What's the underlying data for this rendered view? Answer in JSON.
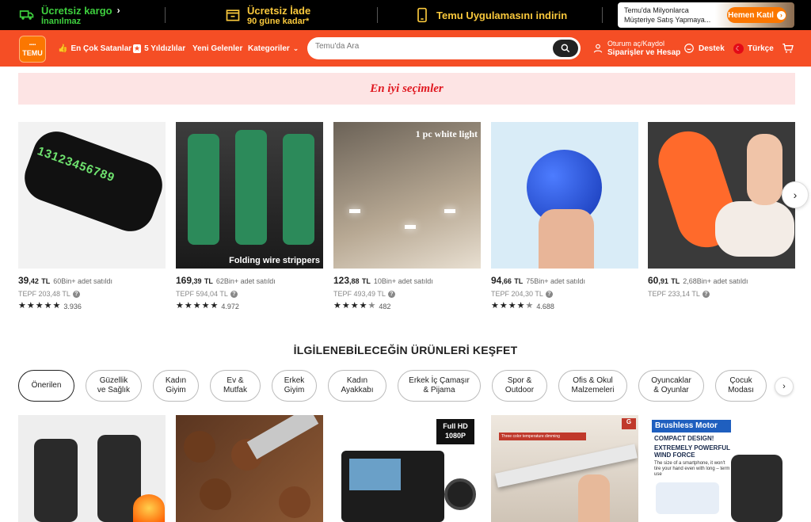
{
  "promo": {
    "shipping_title": "Ücretsiz kargo",
    "shipping_sub": "İnanılmaz",
    "return_title": "Ücretsiz İade",
    "return_sub": "90 güne kadar*",
    "app_title": "Temu Uygulamasını indirin",
    "ad_line1": "Temu'da Milyonlarca",
    "ad_line2": "Müşteriye Satış Yapmaya...",
    "ad_button": "Hemen Katıl"
  },
  "header": {
    "logo_top": "▪▪▪▪",
    "logo_text": "TEMU",
    "nav": [
      "En Çok Satanlar",
      "5 Yıldızlılar",
      "Yeni Gelenler",
      "Kategoriler"
    ],
    "search_placeholder": "Temu'da Ara",
    "account_line1": "Oturum aç/Kaydol",
    "account_line2": "Siparişler ve Hesap",
    "support": "Destek",
    "language": "Türkçe"
  },
  "banner": {
    "title": "En iyi seçimler"
  },
  "products": [
    {
      "price_int": "39",
      "price_dec": ",42",
      "currency": "TL",
      "sold": "60Bin+ adet satıldı",
      "rrp": "TEPF 203,48 TL",
      "stars": 5,
      "reviews": "3.936",
      "image_text": "13123456789"
    },
    {
      "price_int": "169",
      "price_dec": ",39",
      "currency": "TL",
      "sold": "62Bin+ adet satıldı",
      "rrp": "TEPF 594,04 TL",
      "stars": 5,
      "reviews": "4.972",
      "image_text": "Folding wire strippers"
    },
    {
      "price_int": "123",
      "price_dec": ",88",
      "currency": "TL",
      "sold": "10Bin+ adet satıldı",
      "rrp": "TEPF 493,49 TL",
      "stars": 4.5,
      "reviews": "482",
      "image_text": "1 pc white light"
    },
    {
      "price_int": "94",
      "price_dec": ",66",
      "currency": "TL",
      "sold": "75Bin+ adet satıldı",
      "rrp": "TEPF 204,30 TL",
      "stars": 4.5,
      "reviews": "4.688",
      "image_text": ""
    },
    {
      "price_int": "60",
      "price_dec": ",91",
      "currency": "TL",
      "sold": "2,68Bin+ adet satıldı",
      "rrp": "TEPF 233,14 TL",
      "stars": 0,
      "reviews": "",
      "image_text": ""
    }
  ],
  "explore": {
    "title": "İLGİLENEBİLECEĞİN ÜRÜNLERİ KEŞFET"
  },
  "categories": [
    "Önerilen",
    "Güzellik\nve Sağlık",
    "Kadın\nGiyim",
    "Ev &\nMutfak",
    "Erkek\nGiyim",
    "Kadın\nAyakkabı",
    "Erkek İç Çamaşır\n& Pijama",
    "Spor &\nOutdoor",
    "Ofis & Okul\nMalzemeleri",
    "Oyuncaklar\n& Oyunlar",
    "Çocuk\nModası"
  ],
  "products2": [
    {
      "image_text": ""
    },
    {
      "image_text": ""
    },
    {
      "image_text": "Full HD 1080P"
    },
    {
      "image_text": "Three color temperature dimming"
    },
    {
      "image_text": "Brushless Motor",
      "sub1": "COMPACT DESIGN!",
      "sub2": "EXTREMELY POWERFUL",
      "sub3": "WIND FORCE",
      "sub4": "The size of a smartphone, it won't tire your hand even with long – term use"
    }
  ],
  "colors": {
    "brand_orange": "#f54e25",
    "promo_gold": "#f9c83c",
    "banner_bg": "#fde4e4",
    "banner_text": "#e0171f"
  }
}
